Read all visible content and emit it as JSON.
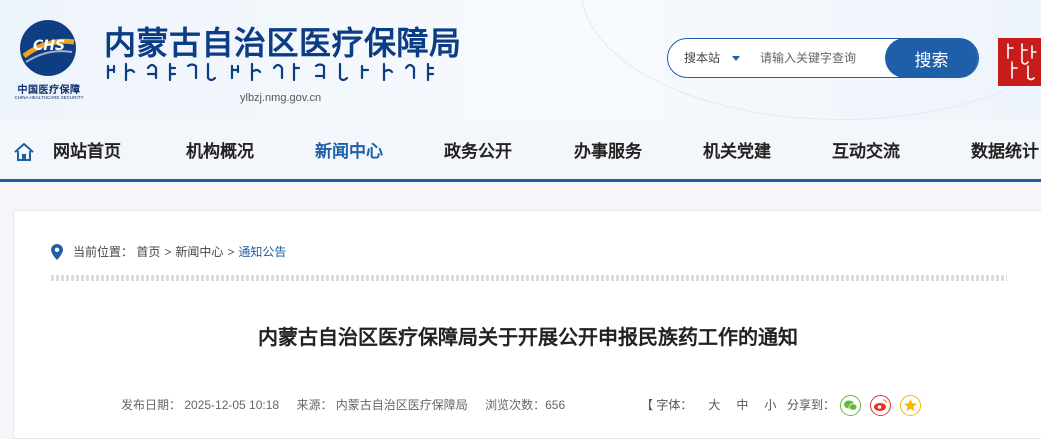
{
  "header": {
    "logo_cn": "中国医疗保障",
    "logo_en": "CHINA HEALTHCARE SECURITY",
    "logo_mark": "CHS",
    "site_title": "内蒙古自治区医疗保障局",
    "site_domain": "ylbzj.nmg.gov.cn"
  },
  "search": {
    "scope_label": "搜本站",
    "placeholder": "请输入关键字查询",
    "button_label": "搜索"
  },
  "nav": {
    "items": [
      {
        "label": "网站首页"
      },
      {
        "label": "机构概况"
      },
      {
        "label": "新闻中心"
      },
      {
        "label": "政务公开"
      },
      {
        "label": "办事服务"
      },
      {
        "label": "机关党建"
      },
      {
        "label": "互动交流"
      },
      {
        "label": "数据统计"
      }
    ],
    "active": "新闻中心"
  },
  "breadcrumb": {
    "prefix": "当前位置：",
    "items": [
      "首页",
      "新闻中心",
      "通知公告"
    ],
    "separator": ">"
  },
  "article": {
    "title": "内蒙古自治区医疗保障局关于开展公开申报民族药工作的通知",
    "publish_date": "发布日期：  2025-12-05 10:18",
    "source": "来源：  内蒙古自治区医疗保障局",
    "views": "浏览次数：656"
  },
  "font_size": {
    "label": "【 字体：",
    "options": [
      "大",
      "中",
      "小"
    ]
  },
  "share": {
    "label": "分享到：",
    "targets": [
      "wechat-icon",
      "weibo-icon",
      "qzone-icon"
    ]
  },
  "colors": {
    "primary": "#1f5fa9",
    "title": "#0c3c86",
    "mongolian_badge": "#c81b1b",
    "wechat": "#5fbb3d",
    "weibo": "#e6332a",
    "qzone": "#f5b800"
  }
}
